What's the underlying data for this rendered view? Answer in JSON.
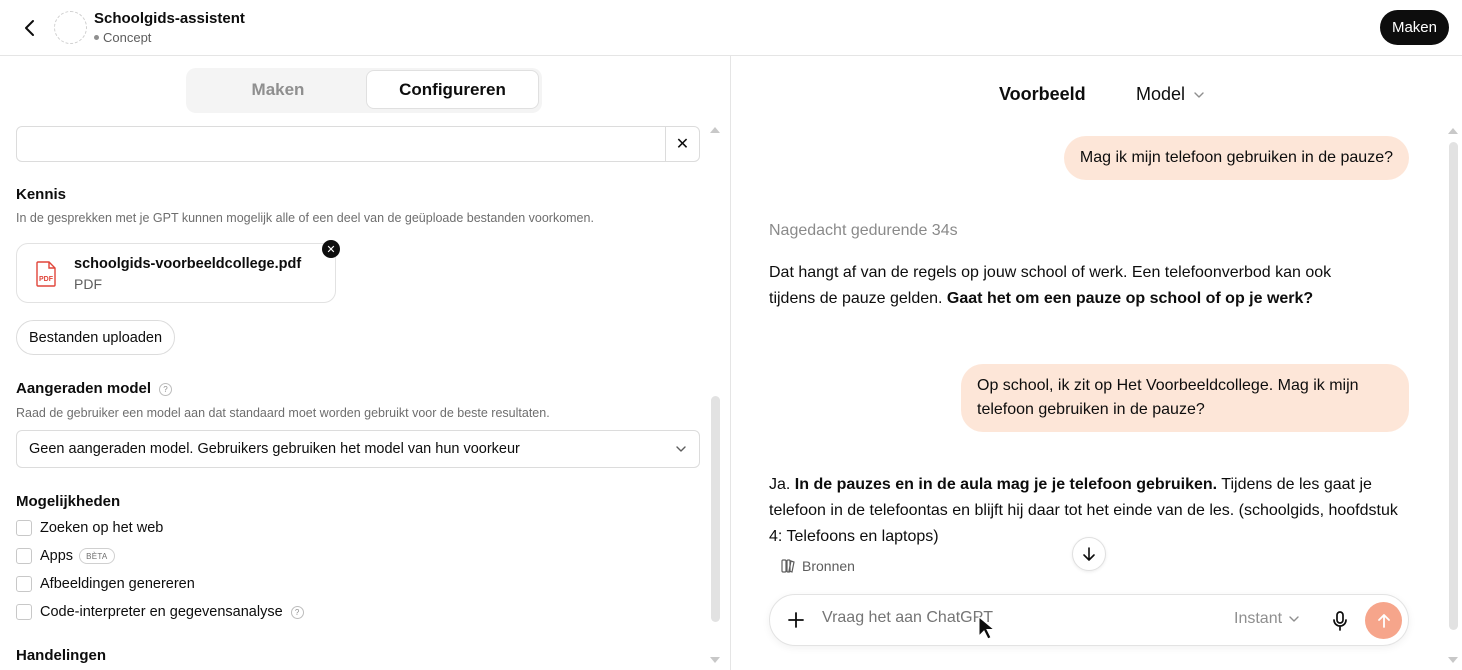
{
  "header": {
    "title": "Schoolgids-assistent",
    "status": "Concept",
    "make_button": "Maken"
  },
  "left": {
    "tabs": [
      {
        "label": "Maken",
        "active": false
      },
      {
        "label": "Configureren",
        "active": true
      }
    ],
    "clear_icon": "close-icon",
    "knowledge": {
      "title": "Kennis",
      "description": "In de gesprekken met je GPT kunnen mogelijk alle of een deel van de geüploade bestanden voorkomen.",
      "file": {
        "name": "schoolgids-voorbeeldcollege.pdf",
        "type": "PDF",
        "icon_label": "PDF"
      },
      "upload_button": "Bestanden uploaden"
    },
    "recommended_model": {
      "title": "Aangeraden model",
      "help": "?",
      "description": "Raad de gebruiker een model aan dat standaard moet worden gebruikt voor de beste resultaten.",
      "selected": "Geen aangeraden model. Gebruikers gebruiken het model van hun voorkeur"
    },
    "capabilities": {
      "title": "Mogelijkheden",
      "items": [
        {
          "label": "Zoeken op het web",
          "checked": false
        },
        {
          "label": "Apps",
          "checked": false,
          "badge": "BÈTA"
        },
        {
          "label": "Afbeeldingen genereren",
          "checked": false
        },
        {
          "label": "Code-interpreter en gegevensanalyse",
          "checked": false,
          "help": "?"
        }
      ]
    },
    "actions": {
      "title": "Handelingen"
    }
  },
  "right": {
    "title": "Voorbeeld",
    "model_dropdown": "Model",
    "messages": {
      "user1": "Mag ik mijn telefoon gebruiken in de pauze?",
      "thought": "Nagedacht gedurende 34s",
      "assistant1_a": "Dat hangt af van de regels op jouw school of werk. Een telefoonverbod kan ook tijdens de pauze gelden. ",
      "assistant1_b": "Gaat het om een pauze op school of op je werk?",
      "user2": "Op school, ik zit op Het Voorbeeldcollege. Mag ik mijn telefoon gebruiken in de pauze?",
      "assistant2_a": "Ja. ",
      "assistant2_b": "In de pauzes en in de aula mag je je telefoon gebruiken.",
      "assistant2_c": " Tijdens de les gaat je telefoon in de telefoontas en blijft hij daar tot het einde van de les. (schoolgids, hoofdstuk 4: Telefoons en laptops)"
    },
    "sources_button": "Bronnen",
    "composer": {
      "placeholder": "Vraag het aan ChatGPT",
      "mode": "Instant"
    },
    "colors": {
      "user_bubble": "#fde6d8",
      "send_button": "#f6a58b"
    }
  }
}
